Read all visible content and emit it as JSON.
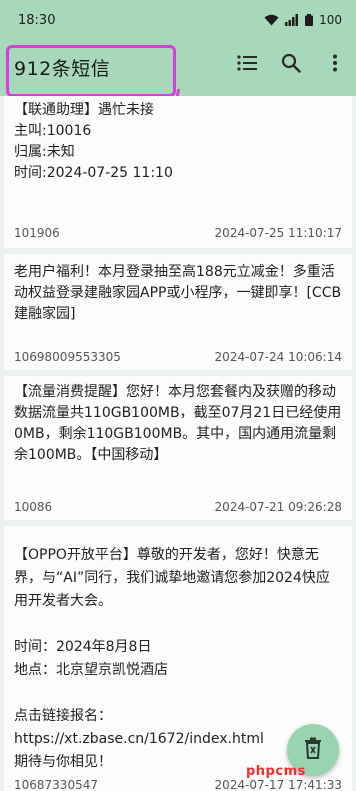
{
  "status_bar": {
    "time": "18:30",
    "battery": "100",
    "icons": [
      "wifi-icon",
      "signal-icon",
      "battery-icon"
    ]
  },
  "app_bar": {
    "title": "912条短信",
    "actions": [
      "list-icon",
      "search-icon",
      "more-vert-icon"
    ],
    "highlight_color": "#d63fd9"
  },
  "messages": [
    {
      "body": "【联通助理】遇忙未接\n主叫:10016\n归属:未知\n时间:2024-07-25 11:10",
      "sender": "101906",
      "date": "2024-07-25 11:10:17"
    },
    {
      "body": "老用户福利！本月登录抽至高188元立减金！多重活动权益登录建融家园APP或小程序，一键即享！[CCB建融家园]",
      "sender": "10698009553305",
      "date": "2024-07-24 10:06:14"
    },
    {
      "body": "【流量消费提醒】您好！本月您套餐内及获赠的移动数据流量共110GB100MB，截至07月21日已经使用0MB，剩余110GB100MB。其中，国内通用流量剩余100MB。【中国移动】",
      "sender": "10086",
      "date": "2024-07-21 09:26:28"
    },
    {
      "body": "【OPPO开放平台】尊敬的开发者，您好！快意无界，与“AI”同行，我们诚挚地邀请您参加2024快应用开发者大会。\n\n时间：2024年8月8日\n地点：北京望京凯悦酒店\n\n点击链接报名：https://xt.zbase.cn/1672/index.html\n期待与你相见！",
      "sender": "10687330547",
      "date": "2024-07-17 17:41:33"
    }
  ],
  "fab": {
    "icon": "delete-icon"
  },
  "watermark": "phpcms",
  "colors": {
    "app_bar": "#a7d8b9",
    "fab": "#98d4ad",
    "background": "#eef2ee",
    "watermark": "#ff2a2a"
  }
}
